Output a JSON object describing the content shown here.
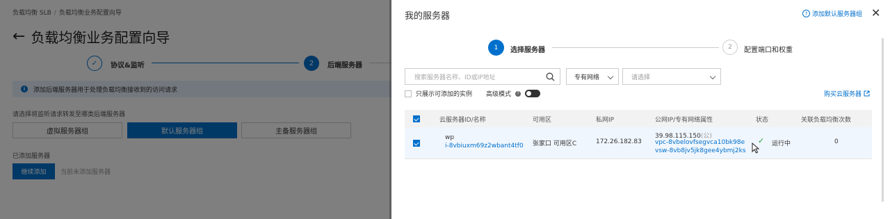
{
  "background_page": {
    "breadcrumb": [
      "负载均衡 SLB",
      "负载均衡业务配置向导"
    ],
    "title": "负载均衡业务配置向导",
    "steps": [
      {
        "num": "✓",
        "label": "协议&监听"
      },
      {
        "num": "2",
        "label": "后端服务器"
      }
    ],
    "info_text": "添加后端服务器用于处理负载均衡接收到的访问请求",
    "select_label": "请选择将监听请求转发至哪类后端服务器",
    "server_group_tabs": [
      "虚拟服务器组",
      "默认服务器组",
      "主备服务器组"
    ],
    "added_label": "已添加服务器",
    "continue_button": "继续添加",
    "none_added": "当前未添加服务器"
  },
  "drawer": {
    "title": "我的服务器",
    "help_link": "添加默认服务器组",
    "steps": [
      {
        "num": "1",
        "label": "选择服务器"
      },
      {
        "num": "2",
        "label": "配置端口和权重"
      }
    ],
    "search_placeholder": "搜索服务器名称、ID或IP地址",
    "network_select": "专有网络",
    "vpc_select_placeholder": "请选择",
    "only_addable_label": "只展示可添加的实例",
    "advanced_mode_label": "高级模式",
    "buy_link": "购买云服务器",
    "table": {
      "headers": [
        "云服务器ID/名称",
        "可用区",
        "私网IP",
        "公网IP/专有网络属性",
        "状态",
        "关联负载均衡次数"
      ],
      "rows": [
        {
          "name": "wp",
          "id": "i-8vbiuxm69z2wbant4tf0",
          "zone": "张家口 可用区C",
          "private_ip": "172.26.182.83",
          "public_ip": "39.98.115.150",
          "public_ip_tag": "(公)",
          "vpc": "vpc-8vbelovfsegvca10bk98e",
          "vsw": "vsw-8vb8jv5jk8gee4ybmj2ks",
          "status": "运行中",
          "lb_count": "0"
        }
      ]
    }
  },
  "colors": {
    "accent": "#0070cc",
    "overlay": "rgba(0,0,0,0.5)",
    "success": "#1e9e3d"
  }
}
